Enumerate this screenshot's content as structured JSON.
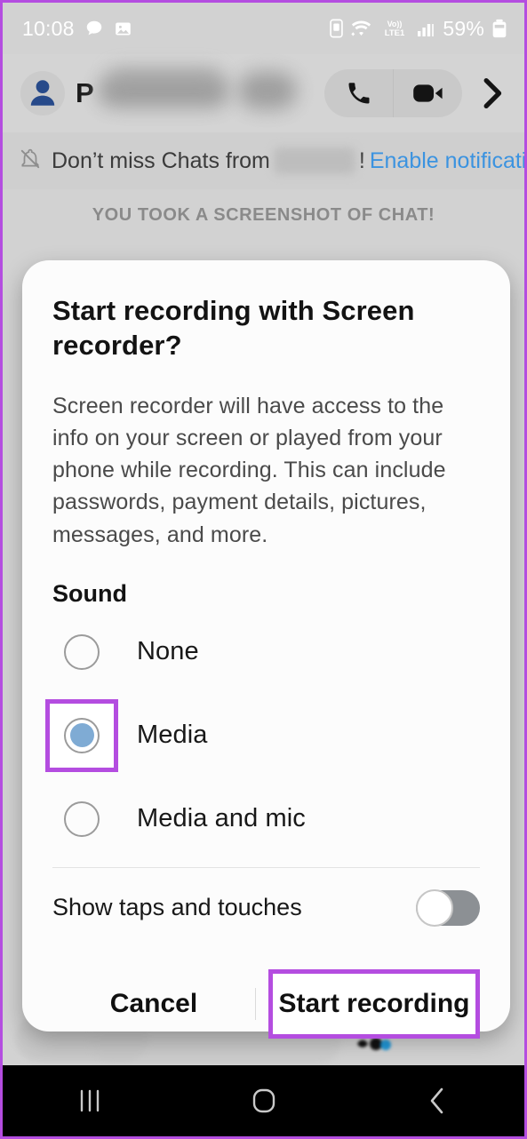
{
  "status_bar": {
    "time": "10:08",
    "battery_percent": "59%",
    "icons": [
      "chat-bubble-icon",
      "gallery-image-icon",
      "sim-card-icon",
      "wifi-icon",
      "volte-lte1-icon",
      "signal-bars-icon",
      "battery-icon"
    ]
  },
  "chat_header": {
    "contact_initial": "P",
    "contact_name_redacted": true,
    "actions": [
      "voice-call-button",
      "video-call-button",
      "expand-chevron-button"
    ]
  },
  "notification_banner": {
    "prefix": "Don’t miss Chats from",
    "suffix": "!",
    "link": "Enable notifications",
    "icon": "bell-off-icon"
  },
  "screenshot_toast": {
    "text": "YOU TOOK A SCREENSHOT OF CHAT!"
  },
  "dialog": {
    "title": "Start recording with Screen recorder?",
    "body": "Screen recorder will have access to the info on your screen or played from your phone while recording. This can include passwords, payment details, pictures, messages, and more.",
    "sound_label": "Sound",
    "sound_options": [
      {
        "label": "None",
        "selected": false,
        "highlighted": false
      },
      {
        "label": "Media",
        "selected": true,
        "highlighted": true
      },
      {
        "label": "Media and mic",
        "selected": false,
        "highlighted": false
      }
    ],
    "toggle": {
      "label": "Show taps and touches",
      "on": false
    },
    "cancel_label": "Cancel",
    "confirm_label": "Start recording",
    "confirm_highlighted": true
  },
  "nav_bar": {
    "recents_label": "recents-button",
    "home_label": "home-button",
    "back_label": "back-button"
  },
  "colors": {
    "annotation_purple": "#b44de0",
    "link_blue": "#3b93e0",
    "radio_selected_blue": "#7fabd4",
    "avatar_blue": "#274a8a",
    "screen_background": "#d2d2d2",
    "dialog_background": "#fcfcfc",
    "nav_background": "#000000"
  }
}
